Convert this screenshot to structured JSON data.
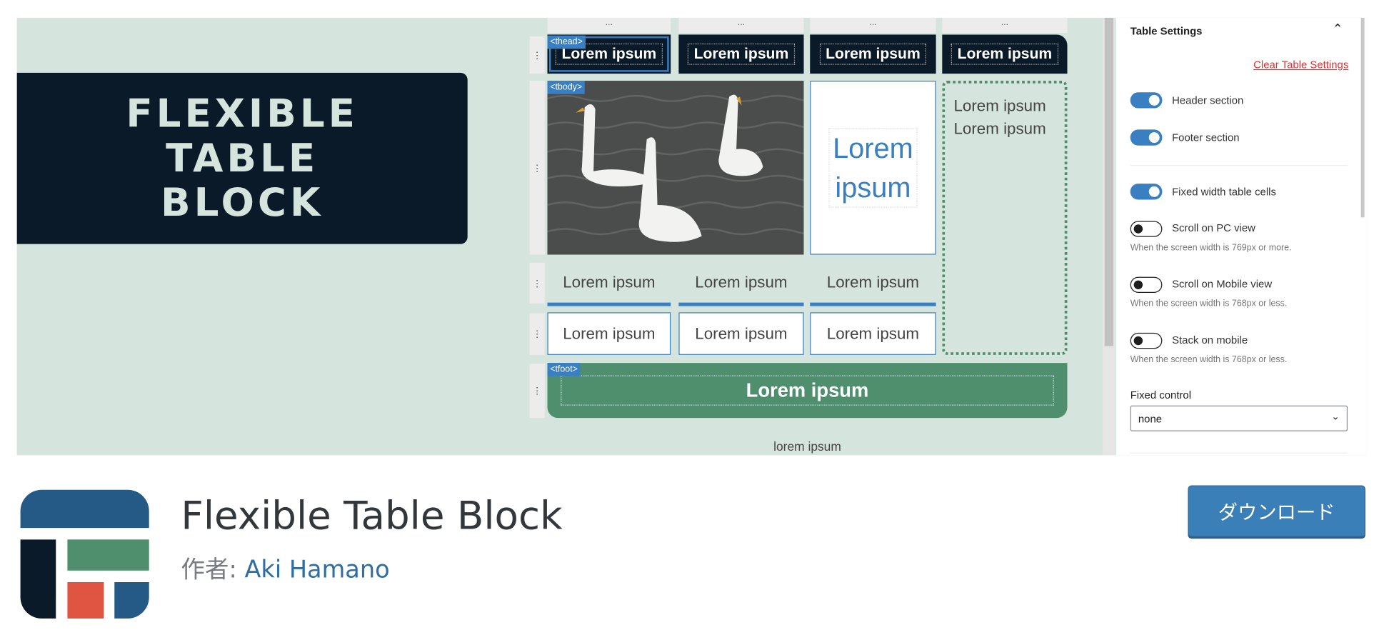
{
  "banner": {
    "hero_lines": [
      "FLEXIBLE",
      "TABLE",
      "BLOCK"
    ],
    "table": {
      "column_menu": "...",
      "row_handle": "⋮",
      "thead_tag": "<thead>",
      "tbody_tag": "<tbody>",
      "tfoot_tag": "<tfoot>",
      "header_cells": [
        "Lorem ipsum",
        "Lorem ipsum",
        "Lorem ipsum",
        "Lorem ipsum"
      ],
      "big_cell": "Lorem ipsum",
      "side_cell_lines": [
        "Lorem ipsum",
        "Lorem ipsum"
      ],
      "row2_cells": [
        "Lorem ipsum",
        "Lorem ipsum",
        "Lorem ipsum"
      ],
      "row3_cells": [
        "Lorem ipsum",
        "Lorem ipsum",
        "Lorem ipsum"
      ],
      "footer_cell": "Lorem ipsum",
      "caption": "lorem ipsum"
    },
    "settings": {
      "title": "Table Settings",
      "clear_link": "Clear Table Settings",
      "toggles": [
        {
          "label": "Header section",
          "on": true
        },
        {
          "label": "Footer section",
          "on": true
        },
        {
          "label": "Fixed width table cells",
          "on": true
        },
        {
          "label": "Scroll on PC view",
          "on": false,
          "help": "When the screen width is 769px or more."
        },
        {
          "label": "Scroll on Mobile view",
          "on": false,
          "help": "When the screen width is 768px or less."
        },
        {
          "label": "Stack on mobile",
          "on": false,
          "help": "When the screen width is 768px or less."
        }
      ],
      "fixed_control_label": "Fixed control",
      "fixed_control_value": "none"
    }
  },
  "plugin": {
    "name": "Flexible Table Block",
    "author_prefix": "作者: ",
    "author": "Aki Hamano",
    "download_button": "ダウンロード"
  },
  "colors": {
    "accent": "#3a7fb8",
    "dark": "#0b1a28",
    "green": "#4f8f6e",
    "red": "#e05442",
    "banner_bg": "#d5e4dd",
    "link_red": "#d63638"
  }
}
